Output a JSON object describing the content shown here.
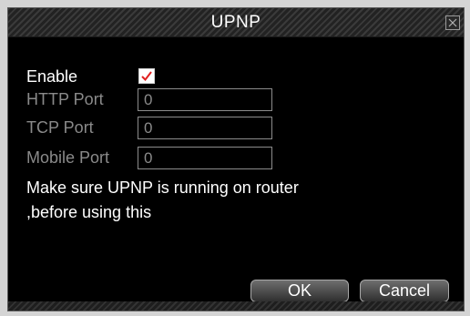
{
  "dialog": {
    "title": "UPNP",
    "close_icon": "close-icon"
  },
  "form": {
    "enable": {
      "label": "Enable",
      "checked": true
    },
    "http_port": {
      "label": "HTTP Port",
      "value": "0"
    },
    "tcp_port": {
      "label": "TCP Port",
      "value": "0"
    },
    "mobile_port": {
      "label": "Mobile Port",
      "value": "0"
    }
  },
  "message": {
    "line1": "Make sure UPNP is running on router",
    "line2": ",before using this"
  },
  "buttons": {
    "ok": "OK",
    "cancel": "Cancel"
  },
  "colors": {
    "background": "#000000",
    "checkmark": "#e02020",
    "disabled_text": "#8a8a8a"
  }
}
